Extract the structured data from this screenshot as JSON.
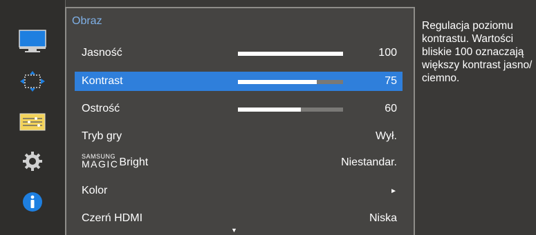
{
  "sidebar": {
    "icons": [
      {
        "name": "monitor-icon",
        "active": true
      },
      {
        "name": "move-arrows-icon",
        "active": false
      },
      {
        "name": "settings-sliders-icon",
        "active": false
      },
      {
        "name": "gear-icon",
        "active": false
      },
      {
        "name": "info-icon",
        "active": false
      }
    ]
  },
  "menu": {
    "title": "Obraz",
    "items": [
      {
        "label": "Jasność",
        "value": "100",
        "bar": 1.0,
        "selected": false
      },
      {
        "label": "Kontrast",
        "value": "75",
        "bar": 0.75,
        "selected": true
      },
      {
        "label": "Ostrość",
        "value": "60",
        "bar": 0.6,
        "selected": false
      },
      {
        "label": "Tryb gry",
        "value": "Wył.",
        "selected": false
      },
      {
        "label_prefix_top": "SAMSUNG",
        "label_prefix_bottom": "MAGIC",
        "label": "Bright",
        "value": "Niestandar.",
        "selected": false
      },
      {
        "label": "Kolor",
        "value": "►",
        "selected": false
      },
      {
        "label": "Czerń HDMI",
        "value": "Niska",
        "selected": false
      }
    ],
    "scroll_indicator": "▼"
  },
  "help": {
    "text": "Regulacja poziomu kontrastu. Wartości bliskie 100 oznaczają większy kontrast jasno/ ciemno."
  },
  "colors": {
    "background": "#3a3937",
    "menu_panel": "#454442",
    "selected_row": "#2f7fdb",
    "title": "#7fb0e6",
    "info_icon": "#1e7fe0"
  }
}
